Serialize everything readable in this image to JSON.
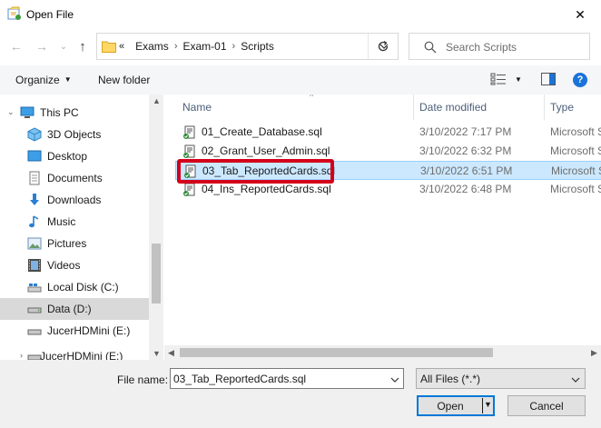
{
  "window": {
    "title": "Open File",
    "close_glyph": "✕",
    "app_icon": "open-file-app-icon"
  },
  "nav": {
    "back_glyph": "←",
    "forward_glyph": "→",
    "recent_glyph": "⌄",
    "up_glyph": "↑"
  },
  "address": {
    "overflow": "«",
    "crumbs": [
      "Exams",
      "Exam-01",
      "Scripts"
    ],
    "separator": "›"
  },
  "search": {
    "placeholder": "Search Scripts"
  },
  "toolbar": {
    "organize_label": "Organize",
    "new_folder_label": "New folder",
    "help_glyph": "?"
  },
  "sidebar": {
    "items": [
      {
        "label": "This PC",
        "icon": "this-pc-icon"
      },
      {
        "label": "3D Objects",
        "icon": "3d-objects-icon"
      },
      {
        "label": "Desktop",
        "icon": "desktop-icon"
      },
      {
        "label": "Documents",
        "icon": "documents-icon"
      },
      {
        "label": "Downloads",
        "icon": "downloads-icon"
      },
      {
        "label": "Music",
        "icon": "music-icon"
      },
      {
        "label": "Pictures",
        "icon": "pictures-icon"
      },
      {
        "label": "Videos",
        "icon": "videos-icon"
      },
      {
        "label": "Local Disk (C:)",
        "icon": "local-disk-icon"
      },
      {
        "label": "Data (D:)",
        "icon": "drive-icon",
        "selected": true
      },
      {
        "label": "JucerHDMini (E:)",
        "icon": "usb-drive-icon"
      },
      {
        "label": "JucerHDMini (E:)",
        "icon": "usb-drive-icon"
      }
    ]
  },
  "files": {
    "columns": {
      "name": "Name",
      "date": "Date modified",
      "type": "Type"
    },
    "rows": [
      {
        "name": "01_Create_Database.sql",
        "date": "3/10/2022 7:17 PM",
        "type": "Microsoft SQL Server Query File"
      },
      {
        "name": "02_Grant_User_Admin.sql",
        "date": "3/10/2022 6:32 PM",
        "type": "Microsoft SQL Server Query File"
      },
      {
        "name": "03_Tab_ReportedCards.sql",
        "date": "3/10/2022 6:51 PM",
        "type": "Microsoft SQL Server Query File",
        "selected": true
      },
      {
        "name": "04_Ins_ReportedCards.sql",
        "date": "3/10/2022 6:48 PM",
        "type": "Microsoft SQL Server Query File"
      }
    ]
  },
  "bottom": {
    "filename_label": "File name:",
    "filename_value": "03_Tab_ReportedCards.sql",
    "filter_value": "All Files (*.*)",
    "open_label": "Open",
    "cancel_label": "Cancel"
  },
  "colors": {
    "accent": "#0078d7",
    "selection": "#cce8ff",
    "highlight_annotation": "#d4001a"
  }
}
